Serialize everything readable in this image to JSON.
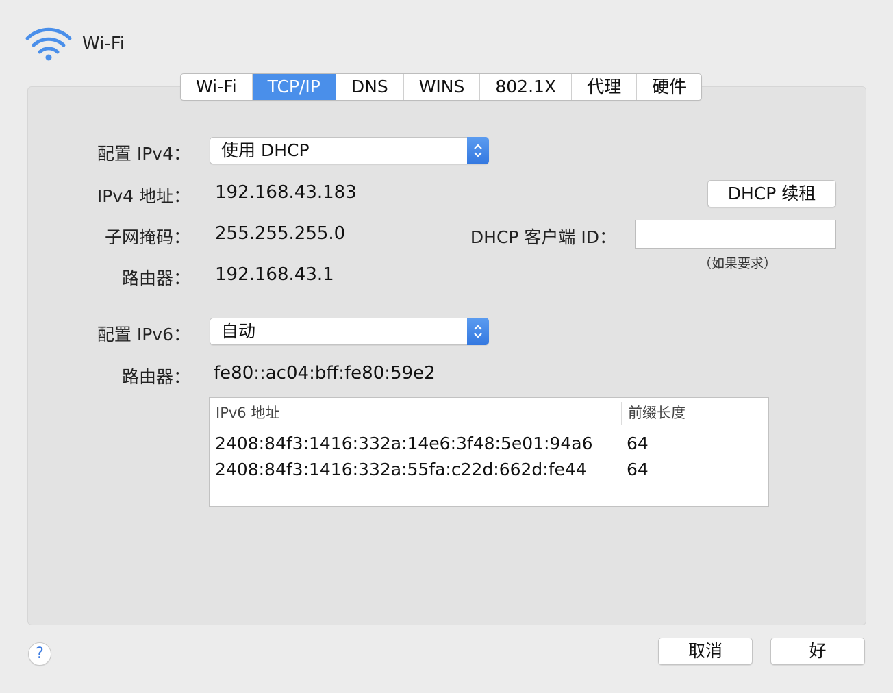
{
  "window": {
    "title": "Wi-Fi",
    "icon": "wifi-icon"
  },
  "tabs": [
    {
      "label": "Wi-Fi",
      "active": false
    },
    {
      "label": "TCP/IP",
      "active": true
    },
    {
      "label": "DNS",
      "active": false
    },
    {
      "label": "WINS",
      "active": false
    },
    {
      "label": "802.1X",
      "active": false
    },
    {
      "label": "代理",
      "active": false
    },
    {
      "label": "硬件",
      "active": false
    }
  ],
  "ipv4": {
    "config_label": "配置 IPv4：",
    "config_value": "使用 DHCP",
    "address_label": "IPv4 地址：",
    "address": "192.168.43.183",
    "subnet_label": "子网掩码：",
    "subnet": "255.255.255.0",
    "router_label": "路由器：",
    "router": "192.168.43.1"
  },
  "dhcp": {
    "renew_button": "DHCP 续租",
    "client_id_label": "DHCP 客户端 ID：",
    "client_id_value": "",
    "client_id_hint": "（如果要求）"
  },
  "ipv6": {
    "config_label": "配置 IPv6：",
    "config_value": "自动",
    "router_label": "路由器：",
    "router": "fe80::ac04:bff:fe80:59e2",
    "table": {
      "headers": [
        "IPv6 地址",
        "前缀长度"
      ],
      "rows": [
        [
          "2408:84f3:1416:332a:14e6:3f48:5e01:94a6",
          "64"
        ],
        [
          "2408:84f3:1416:332a:55fa:c22d:662d:fe44",
          "64"
        ]
      ]
    }
  },
  "footer": {
    "help": "?",
    "cancel": "取消",
    "ok": "好"
  },
  "colors": {
    "accent": "#4a8fea",
    "panel": "#e3e3e3",
    "background": "#ececec"
  }
}
